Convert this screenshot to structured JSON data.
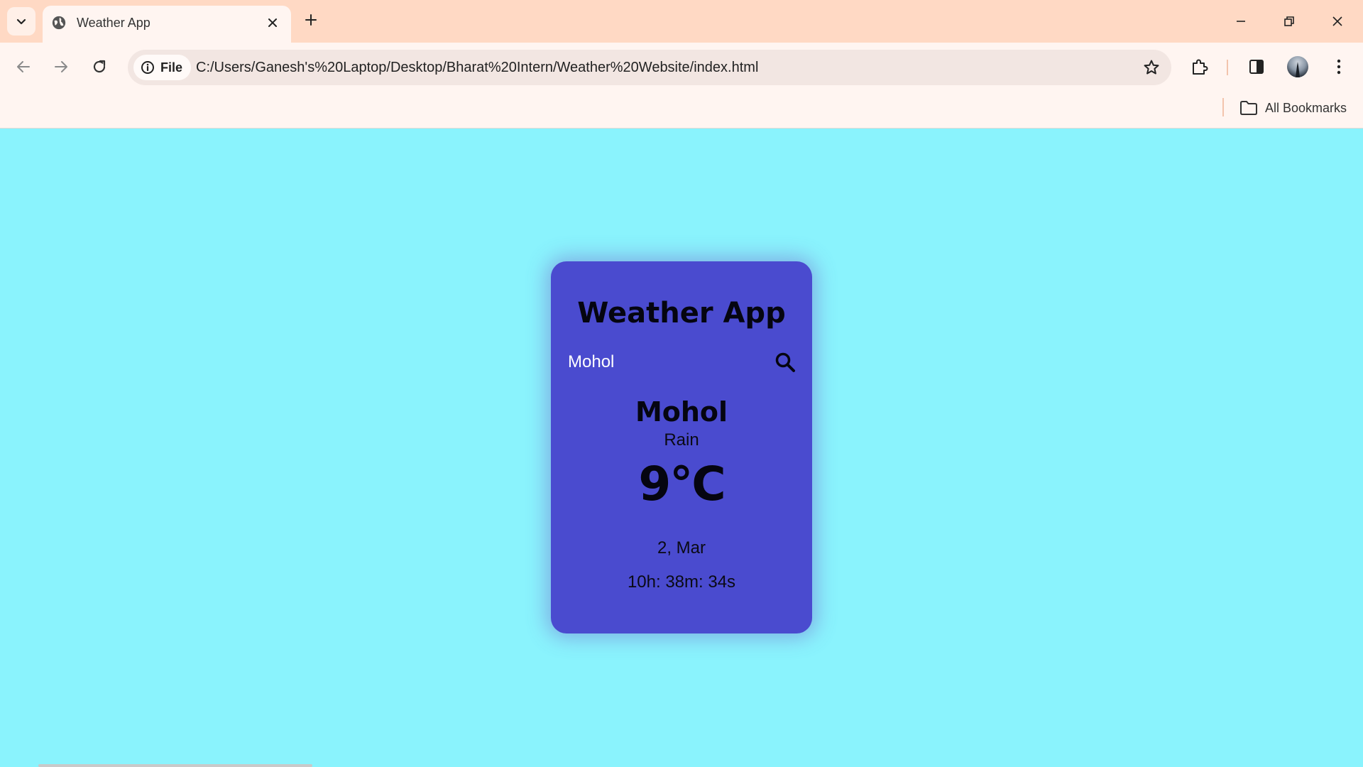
{
  "browser": {
    "tab": {
      "title": "Weather App"
    },
    "site_info": {
      "label": "File"
    },
    "address_bar": {
      "url": "C:/Users/Ganesh's%20Laptop/Desktop/Bharat%20Intern/Weather%20Website/index.html"
    },
    "bookmarks": {
      "all_bookmarks_label": "All Bookmarks"
    },
    "icons": {
      "tab_search": "chevron-down-icon",
      "favicon": "globe-icon",
      "tab_close": "close-icon",
      "new_tab": "plus-icon",
      "minimize": "minimize-icon",
      "restore": "restore-icon",
      "close_window": "close-icon",
      "back": "arrow-left-icon",
      "forward": "arrow-right-icon",
      "reload": "reload-icon",
      "site_info": "info-icon",
      "bookmark_star": "star-icon",
      "extensions": "puzzle-icon",
      "side_panel": "side-panel-icon",
      "profile": "avatar",
      "menu": "kebab-menu-icon",
      "bookmarks_folder": "folder-icon"
    }
  },
  "app": {
    "title": "Weather App",
    "search": {
      "value": "Mohol",
      "placeholder": ""
    },
    "weather": {
      "city": "Mohol",
      "condition": "Rain",
      "temperature": "9°C",
      "date": "2, Mar",
      "time": "10h: 38m: 34s"
    },
    "colors": {
      "page_background": "#8af3fd",
      "card_background": "#4a4bcf",
      "browser_frame": "#ffd9c4"
    }
  }
}
